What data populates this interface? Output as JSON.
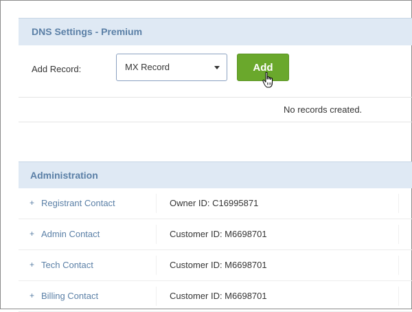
{
  "dns": {
    "title": "DNS Settings - Premium",
    "add_record_label": "Add Record:",
    "record_type_selected": "MX Record",
    "add_button_label": "Add",
    "no_records_text": "No records created."
  },
  "administration": {
    "title": "Administration",
    "contacts": [
      {
        "label": "Registrant Contact",
        "id_text": "Owner ID: C16995871"
      },
      {
        "label": "Admin Contact",
        "id_text": "Customer ID: M6698701"
      },
      {
        "label": "Tech Contact",
        "id_text": "Customer ID: M6698701"
      },
      {
        "label": "Billing Contact",
        "id_text": "Customer ID: M6698701"
      }
    ]
  },
  "colors": {
    "header_bg": "#dfe9f4",
    "header_text": "#5a7fa6",
    "add_button": "#6aa82c",
    "link": "#5a7fa6"
  },
  "icons": {
    "expand": "plus-icon",
    "dropdown": "chevron-down-icon",
    "cursor": "hand-pointer-icon"
  }
}
